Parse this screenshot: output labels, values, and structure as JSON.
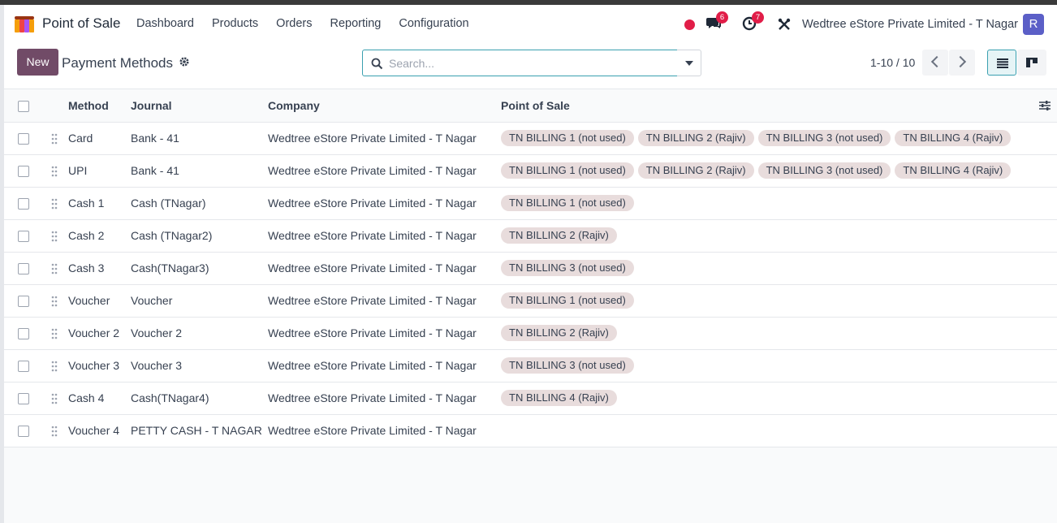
{
  "navbar": {
    "app_name": "Point of Sale",
    "menu": [
      "Dashboard",
      "Products",
      "Orders",
      "Reporting",
      "Configuration"
    ],
    "messages_count": "6",
    "activities_count": "7",
    "company": "Wedtree eStore Private Limited - T Nagar",
    "avatar_initial": "R",
    "colors": {
      "avatar": "#5b5fc7",
      "badge": "#e11d48"
    }
  },
  "control": {
    "new_label": "New",
    "title": "Payment Methods",
    "search_placeholder": "Search...",
    "pager": "1-10 / 10"
  },
  "table": {
    "columns": [
      "Method",
      "Journal",
      "Company",
      "Point of Sale"
    ],
    "rows": [
      {
        "method": "Card",
        "journal": "Bank - 41",
        "company": "Wedtree eStore Private Limited - T Nagar",
        "pos": [
          "TN BILLING 1 (not used)",
          "TN BILLING 2 (Rajiv)",
          "TN BILLING 3 (not used)",
          "TN BILLING 4 (Rajiv)"
        ]
      },
      {
        "method": "UPI",
        "journal": "Bank - 41",
        "company": "Wedtree eStore Private Limited - T Nagar",
        "pos": [
          "TN BILLING 1 (not used)",
          "TN BILLING 2 (Rajiv)",
          "TN BILLING 3 (not used)",
          "TN BILLING 4 (Rajiv)"
        ]
      },
      {
        "method": "Cash 1",
        "journal": "Cash (TNagar)",
        "company": "Wedtree eStore Private Limited - T Nagar",
        "pos": [
          "TN BILLING 1 (not used)"
        ]
      },
      {
        "method": "Cash 2",
        "journal": "Cash (TNagar2)",
        "company": "Wedtree eStore Private Limited - T Nagar",
        "pos": [
          "TN BILLING 2 (Rajiv)"
        ]
      },
      {
        "method": "Cash 3",
        "journal": "Cash(TNagar3)",
        "company": "Wedtree eStore Private Limited - T Nagar",
        "pos": [
          "TN BILLING 3 (not used)"
        ]
      },
      {
        "method": "Voucher",
        "journal": "Voucher",
        "company": "Wedtree eStore Private Limited - T Nagar",
        "pos": [
          "TN BILLING 1 (not used)"
        ]
      },
      {
        "method": "Voucher 2",
        "journal": "Voucher 2",
        "company": "Wedtree eStore Private Limited - T Nagar",
        "pos": [
          "TN BILLING 2 (Rajiv)"
        ]
      },
      {
        "method": "Voucher 3",
        "journal": "Voucher 3",
        "company": "Wedtree eStore Private Limited - T Nagar",
        "pos": [
          "TN BILLING 3 (not used)"
        ]
      },
      {
        "method": "Cash 4",
        "journal": "Cash(TNagar4)",
        "company": "Wedtree eStore Private Limited - T Nagar",
        "pos": [
          "TN BILLING 4 (Rajiv)"
        ]
      },
      {
        "method": "Voucher 4",
        "journal": "PETTY CASH - T NAGAR",
        "company": "Wedtree eStore Private Limited - T Nagar",
        "pos": []
      }
    ]
  }
}
